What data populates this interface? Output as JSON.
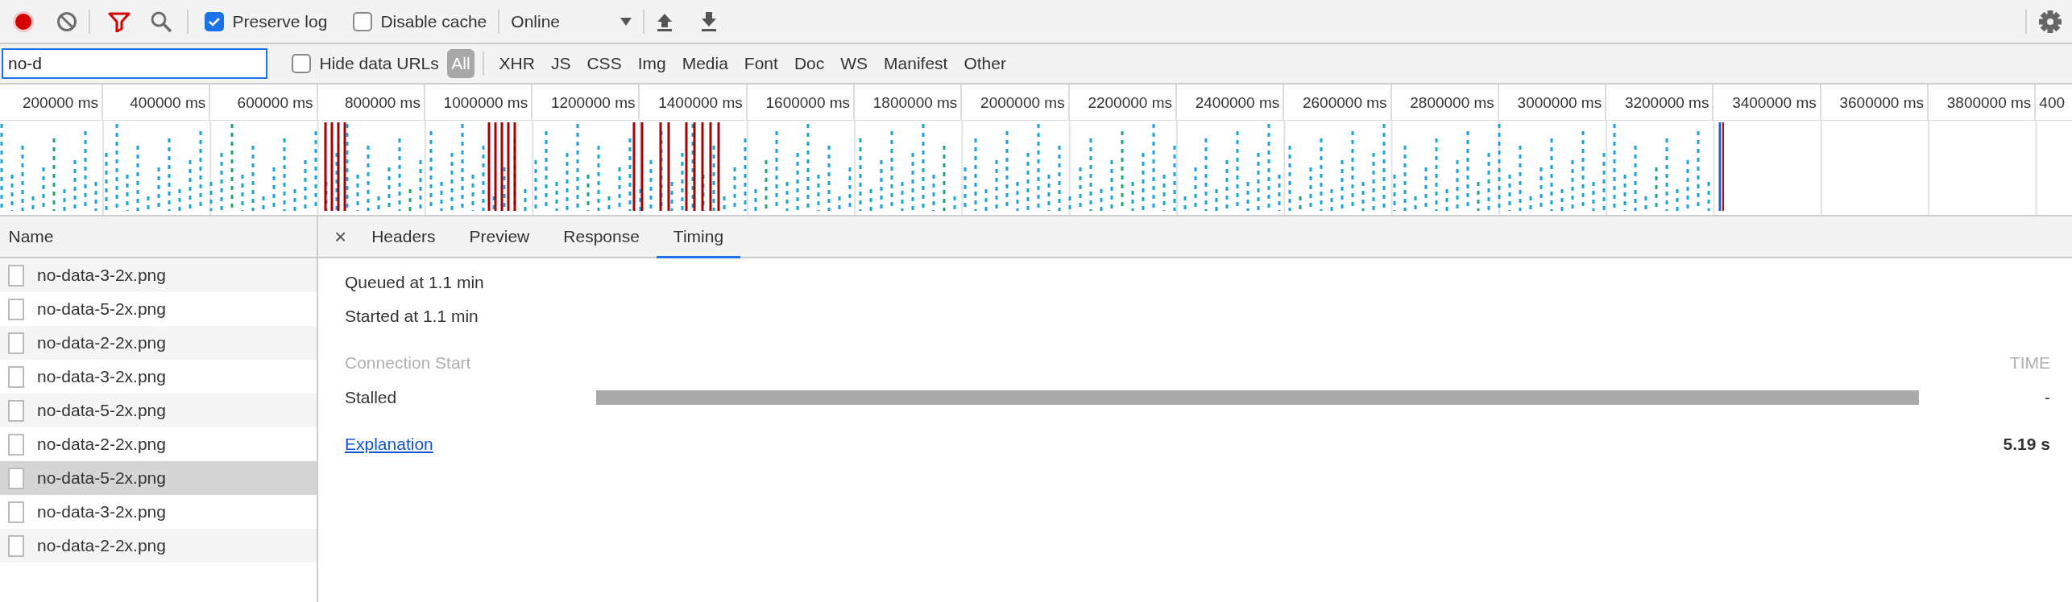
{
  "toolbar": {
    "record": {
      "on": true
    },
    "filter_active": true,
    "preserve_log": {
      "label": "Preserve log",
      "checked": true
    },
    "disable_cache": {
      "label": "Disable cache",
      "checked": false
    },
    "throttling": {
      "value": "Online"
    }
  },
  "filter_bar": {
    "search": {
      "value": "no-d"
    },
    "hide_data_urls": {
      "label": "Hide data URLs",
      "checked": false
    },
    "types": [
      {
        "label": "All",
        "selected": true
      },
      {
        "label": "XHR",
        "selected": false
      },
      {
        "label": "JS",
        "selected": false
      },
      {
        "label": "CSS",
        "selected": false
      },
      {
        "label": "Img",
        "selected": false
      },
      {
        "label": "Media",
        "selected": false
      },
      {
        "label": "Font",
        "selected": false
      },
      {
        "label": "Doc",
        "selected": false
      },
      {
        "label": "WS",
        "selected": false
      },
      {
        "label": "Manifest",
        "selected": false
      },
      {
        "label": "Other",
        "selected": false
      }
    ]
  },
  "timeline": {
    "ticks": [
      "200000 ms",
      "400000 ms",
      "600000 ms",
      "800000 ms",
      "1000000 ms",
      "1200000 ms",
      "1400000 ms",
      "1600000 ms",
      "1800000 ms",
      "2000000 ms",
      "2200000 ms",
      "2400000 ms",
      "2600000 ms",
      "2800000 ms",
      "3000000 ms",
      "3200000 ms",
      "3400000 ms",
      "3600000 ms",
      "3800000 ms",
      "400"
    ]
  },
  "requests": {
    "column": "Name",
    "rows": [
      {
        "name": "no-data-3-2x.png",
        "selected": false
      },
      {
        "name": "no-data-5-2x.png",
        "selected": false
      },
      {
        "name": "no-data-2-2x.png",
        "selected": false
      },
      {
        "name": "no-data-3-2x.png",
        "selected": false
      },
      {
        "name": "no-data-5-2x.png",
        "selected": false
      },
      {
        "name": "no-data-2-2x.png",
        "selected": false
      },
      {
        "name": "no-data-5-2x.png",
        "selected": true
      },
      {
        "name": "no-data-3-2x.png",
        "selected": false
      },
      {
        "name": "no-data-2-2x.png",
        "selected": false
      }
    ]
  },
  "details": {
    "close": "×",
    "tabs": [
      {
        "label": "Headers",
        "selected": false
      },
      {
        "label": "Preview",
        "selected": false
      },
      {
        "label": "Response",
        "selected": false
      },
      {
        "label": "Timing",
        "selected": true
      }
    ],
    "queued": "Queued at 1.1 min",
    "started": "Started at 1.1 min",
    "section": "Connection Start",
    "time_header": "TIME",
    "phases": [
      {
        "label": "Stalled",
        "level": 1,
        "time": "-"
      }
    ],
    "explanation": "Explanation",
    "total": "5.19 s"
  }
}
